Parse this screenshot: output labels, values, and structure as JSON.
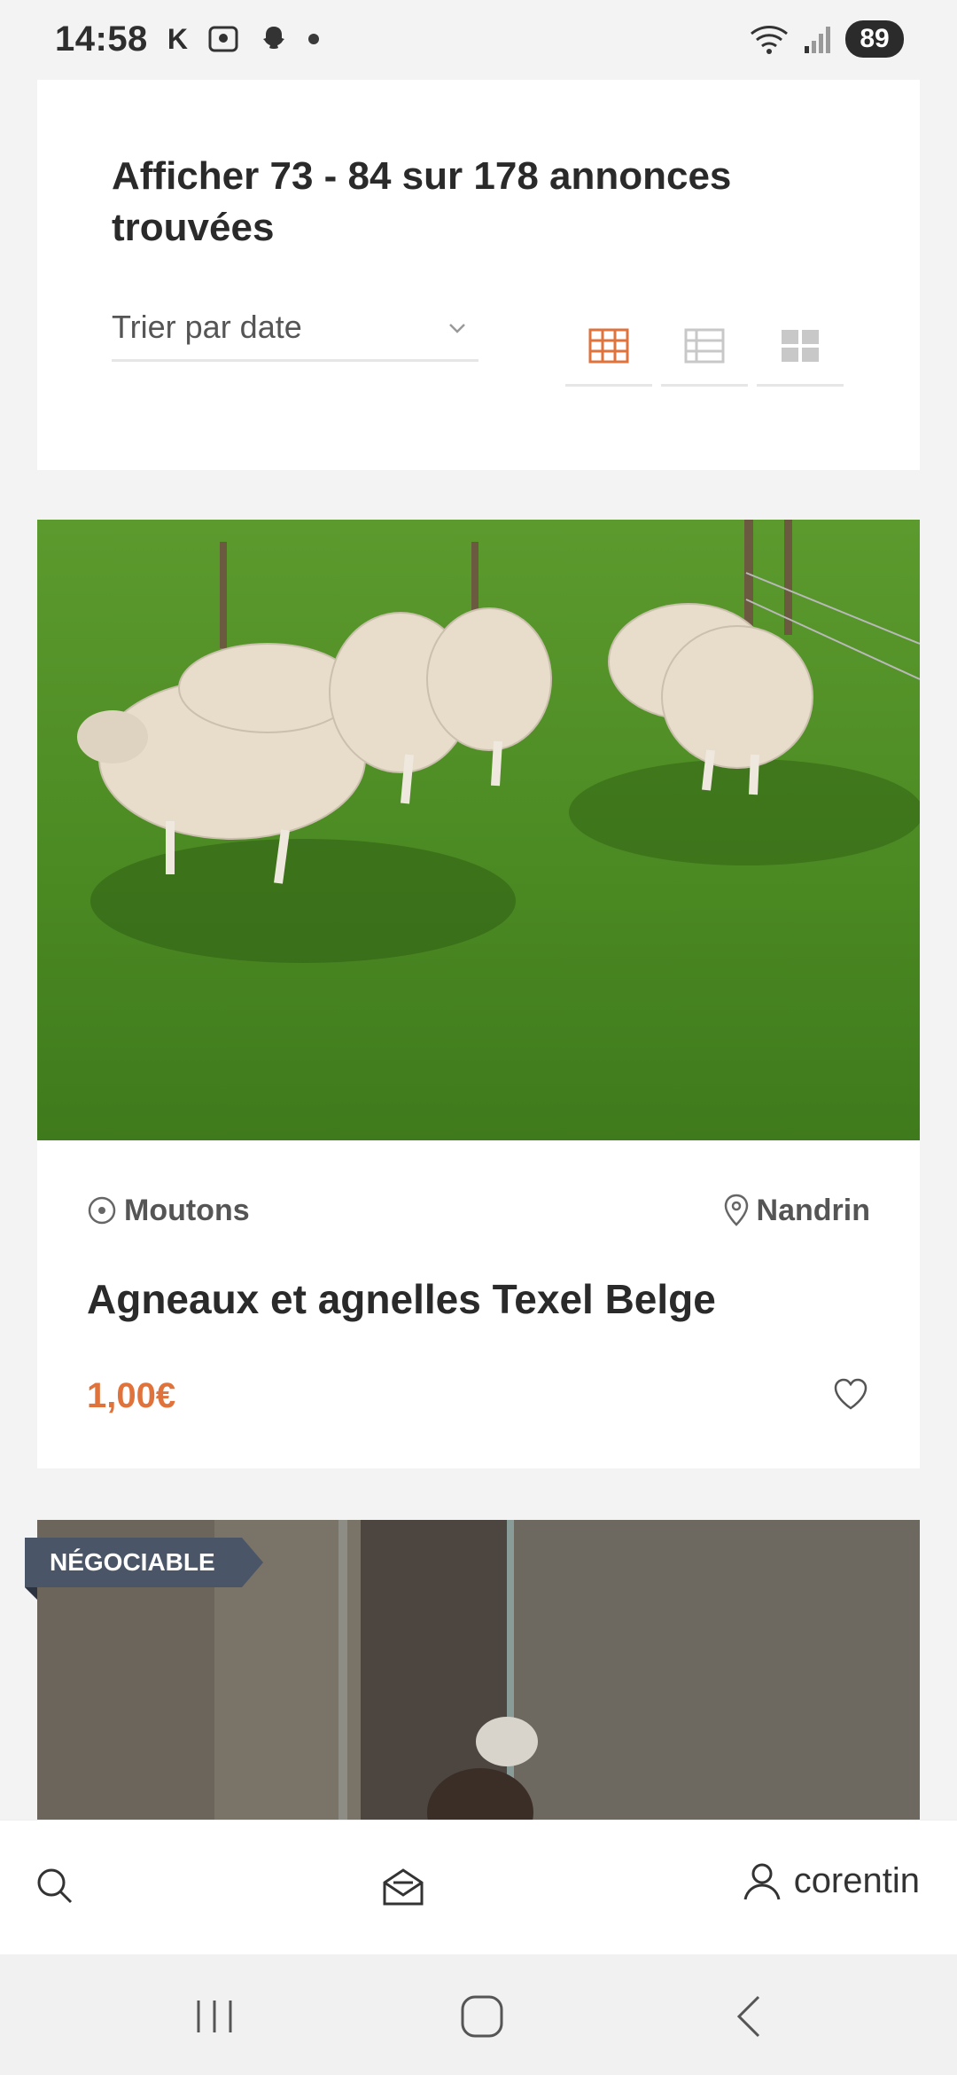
{
  "status_bar": {
    "time": "14:58",
    "indicator_k": "K",
    "battery": "89"
  },
  "header": {
    "results_text": "Afficher 73 - 84 sur 178 annonces trouvées",
    "sort_label": "Trier par date",
    "accent_color": "#e0733b"
  },
  "listing": {
    "category": "Moutons",
    "location": "Nandrin",
    "title": "Agneaux et agnelles Texel Belge",
    "price": "1,00€"
  },
  "listing2": {
    "badge": "NÉGOCIABLE"
  },
  "bottom_nav": {
    "user_name": "corentin"
  }
}
